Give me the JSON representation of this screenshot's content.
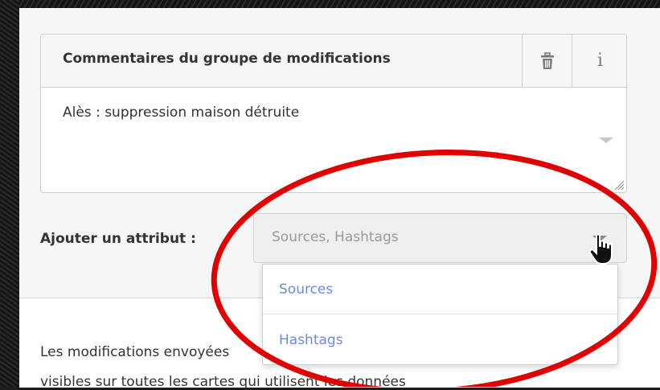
{
  "comment_panel": {
    "title": "Commentaires du groupe de modifications",
    "info_label": "i",
    "text": "Alès : suppression maison détruite"
  },
  "attribute": {
    "label": "Ajouter un attribut :",
    "placeholder": "Sources, Hashtags",
    "options": [
      "Sources",
      "Hashtags"
    ]
  },
  "footer_text": {
    "line1": "Les modifications envoyées",
    "line2": "visibles sur toutes les cartes qui utilisent les données"
  },
  "colors": {
    "link_blue": "#6e87e8",
    "annotation_red": "#e00000"
  }
}
